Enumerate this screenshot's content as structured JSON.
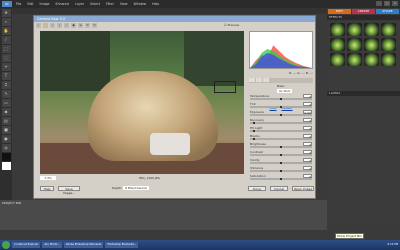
{
  "app": {
    "logo": "Pe",
    "title": "Camera Raw 5.0",
    "menu": [
      "File",
      "Edit",
      "Image",
      "Enhance",
      "Layer",
      "Select",
      "Filter",
      "View",
      "Window",
      "Help"
    ],
    "window_controls": [
      "–",
      "□",
      "×"
    ]
  },
  "raw": {
    "preview_label": "Preview",
    "zoom": "7.4%",
    "filename": "IMG_1490.JPG",
    "depth_label": "Depth:",
    "depth_value": "8 Bits/Channel",
    "rgb_values": "R: --- G: --- B: ---",
    "basic_panel": "Basic",
    "white_balance": "As Shot",
    "auto_label": "Auto",
    "default_label": "Default",
    "sliders": [
      {
        "label": "Temperature",
        "value": "0",
        "pos": 0.5
      },
      {
        "label": "Tint",
        "value": "0",
        "pos": 0.5
      },
      {
        "label": "Exposure",
        "value": "0.00",
        "pos": 0.5
      },
      {
        "label": "Recovery",
        "value": "0",
        "pos": 0.05
      },
      {
        "label": "Fill Light",
        "value": "0",
        "pos": 0.05
      },
      {
        "label": "Blacks",
        "value": "0",
        "pos": 0.05
      },
      {
        "label": "Brightness",
        "value": "0",
        "pos": 0.5
      },
      {
        "label": "Contrast",
        "value": "0",
        "pos": 0.5
      },
      {
        "label": "Clarity",
        "value": "0",
        "pos": 0.5
      },
      {
        "label": "Vibrance",
        "value": "0",
        "pos": 0.5
      },
      {
        "label": "Saturation",
        "value": "0",
        "pos": 0.5
      }
    ],
    "buttons": {
      "help": "Help",
      "save": "Save Image...",
      "done": "Done",
      "cancel": "Cancel",
      "open": "Open Image"
    }
  },
  "right_panel": {
    "tabs": [
      "EDIT",
      "CREATE",
      "SHARE"
    ],
    "effects": "EFFECTS",
    "layers": "LAYERS"
  },
  "bin": {
    "label": "PROJECT BIN"
  },
  "taskbar": {
    "tasks": [
      "2 Internet Explorer",
      "ALL Photo...",
      "Adobe Photoshop Elements",
      "Photoshop Elements..."
    ],
    "tray": "6:12 PM",
    "tooltip": "Show Project Bin"
  }
}
